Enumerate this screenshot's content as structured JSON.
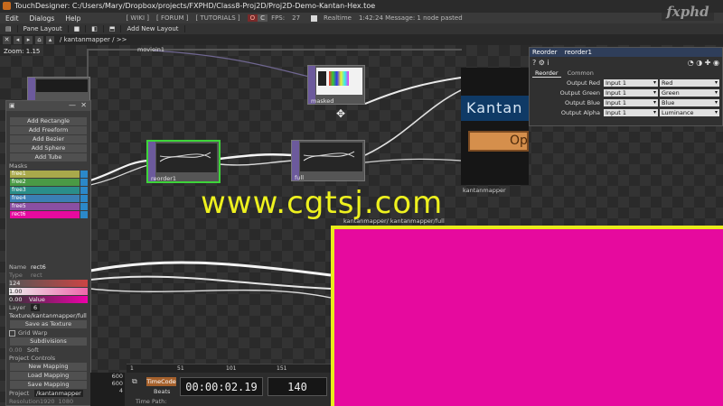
{
  "titlebar": {
    "title": "TouchDesigner: C:/Users/Mary/Dropbox/projects/FXPHD/Class8-Proj2D/Proj2D-Demo-Kantan-Hex.toe"
  },
  "logo": {
    "text": "fxphd"
  },
  "menubar": {
    "items": [
      "Edit",
      "Dialogs",
      "Help"
    ],
    "wiki": "[ WIKI ]",
    "forum": "[ FORUM ]",
    "tutorials": "[ TUTORIALS ]",
    "badge_red": "O",
    "badge_grey": "C",
    "fps_label": "FPS:",
    "fps_value": "27",
    "realtime": "Realtime",
    "message": "1:42:24 Message: 1 node pasted"
  },
  "toolbar": {
    "pane_layout": "Pane Layout",
    "add_new_layout": "Add New Layout"
  },
  "pathbar": {
    "path": "/ kantanmapper / >>"
  },
  "network": {
    "zoom": "Zoom: 1.15",
    "nodes": {
      "movie": "moviein1",
      "masked": "masked",
      "reorder": "reorder1",
      "full": "full",
      "kantanmapper": "kantanmapper",
      "window_label": "kantanmapper/ kantanmapper/full"
    }
  },
  "kantan": {
    "title": "Kantan",
    "button": "Op"
  },
  "leftpanel": {
    "buttons": [
      "Add Rectangle",
      "Add Freeform",
      "Add Bezier",
      "Add Sphere",
      "Add Tube"
    ],
    "masks_heading": "Masks",
    "masks": [
      {
        "name": "free1",
        "color": "#a9a94b"
      },
      {
        "name": "free2",
        "color": "#4a9a45"
      },
      {
        "name": "free3",
        "color": "#2a8e8a"
      },
      {
        "name": "free4",
        "color": "#3b7fb4"
      },
      {
        "name": "free5",
        "color": "#8a4fa2"
      },
      {
        "name": "rect6",
        "color": "#e60a9e"
      }
    ],
    "name_label": "Name",
    "name_value": "rect6",
    "type_label": "Type",
    "type_value": "rect",
    "slider1": "124",
    "slider2": "1.00",
    "slider3": "0.00",
    "value_label": "Value",
    "layer_label": "Layer",
    "layer_value": "6",
    "texture_value": "Texture/kantanmapper/full",
    "save_texture": "Save as Texture",
    "grid_warp": "Grid Warp",
    "subdivisions": "Subdivisions",
    "soft_value": "0.00",
    "soft_label": "Soft",
    "project_controls": "Project Controls",
    "new_mapping": "New Mapping",
    "load_mapping": "Load Mapping",
    "save_mapping": "Save Mapping",
    "project_label": "Project",
    "project_value": "/kantanmapper",
    "resolution_label": "Resolution",
    "res_w": "1920",
    "res_h": "1080"
  },
  "params": {
    "op_type": "Reorder",
    "op_name": "reorder1",
    "tabs": [
      "Reorder",
      "Common"
    ],
    "rows": [
      {
        "label": "Output Red",
        "input": "Input 1",
        "channel": "Red"
      },
      {
        "label": "Output Green",
        "input": "Input 1",
        "channel": "Green"
      },
      {
        "label": "Output Blue",
        "input": "Input 1",
        "channel": "Blue"
      },
      {
        "label": "Output Alpha",
        "input": "Input 1",
        "channel": "Luminance"
      }
    ]
  },
  "timeline": {
    "ticks": [
      "1",
      "51",
      "101",
      "151"
    ],
    "timecode_btn": "TimeCode",
    "beats": "Beats",
    "timecode": "00:00:02.19",
    "frame": "140",
    "time_path": "Time Path:",
    "left_values": [
      "600",
      "600",
      "4"
    ]
  },
  "viewer": {
    "fill": "#e60a9e",
    "border": "#e9ec1a"
  },
  "watermark": {
    "text": "www.cgtsj.com"
  }
}
